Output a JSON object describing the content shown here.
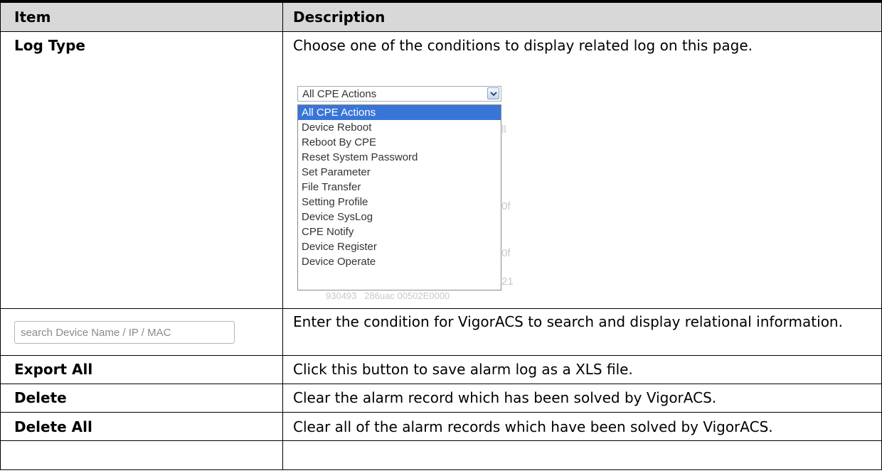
{
  "table": {
    "header": {
      "item": "Item",
      "description": "Description"
    },
    "rows": [
      {
        "item": "Log Type",
        "description": "Choose one of the conditions to display related log on this page."
      },
      {
        "item": "",
        "description": "Enter the condition for VigorACS to search and display relational information."
      },
      {
        "item": "Export All",
        "description": "Click this button to save alarm log as a XLS file."
      },
      {
        "item": "Delete",
        "description": "Clear the alarm record which has been solved by VigorACS."
      },
      {
        "item": "Delete All",
        "description": "Clear all of the alarm records which have been solved by VigorACS."
      }
    ]
  },
  "log_type_select": {
    "selected": "All CPE Actions",
    "options": [
      "All CPE Actions",
      "Device Reboot",
      "Reboot By CPE",
      "Reset System Password",
      "Set Parameter",
      "File Transfer",
      "Setting Profile",
      "Device SysLog",
      "CPE Notify",
      "Device Register",
      "Device Operate"
    ]
  },
  "search": {
    "placeholder": "search Device Name / IP / MAC"
  },
  "colors": {
    "header_bg": "#d8d8d8",
    "selected_option_bg": "#3875d7",
    "border": "#000000"
  }
}
